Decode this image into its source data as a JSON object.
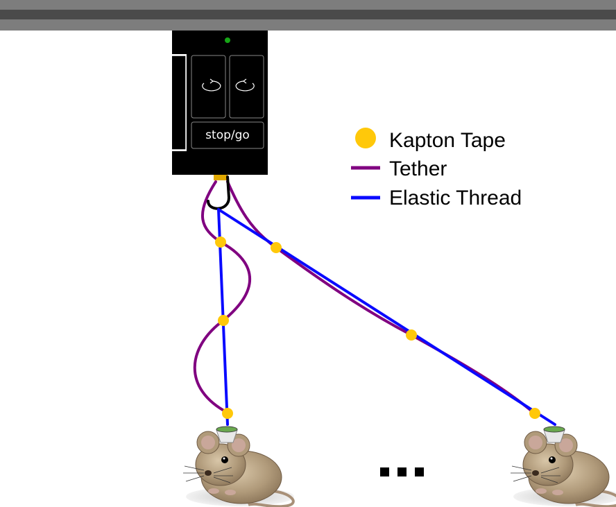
{
  "device": {
    "rotate_left_icon": "rotate-counterclockwise-icon",
    "rotate_right_icon": "rotate-clockwise-icon",
    "stop_go_label": "stop/go",
    "status_led_color": "#16a516"
  },
  "legend": {
    "items": [
      {
        "label": "Kapton Tape",
        "marker": "dot",
        "color": "#ffc80a"
      },
      {
        "label": "Tether",
        "marker": "line",
        "color": "#800080"
      },
      {
        "label": "Elastic Thread",
        "marker": "line",
        "color": "#0a0aff"
      }
    ]
  },
  "ellipsis": "• • •",
  "colors": {
    "rail_outer": "#7d7d7d",
    "rail_inner": "#4a4a4a",
    "device_body": "#000000",
    "tether": "#800080",
    "thread": "#0a0aff",
    "tape": "#ffc80a",
    "hook": "#000000"
  }
}
